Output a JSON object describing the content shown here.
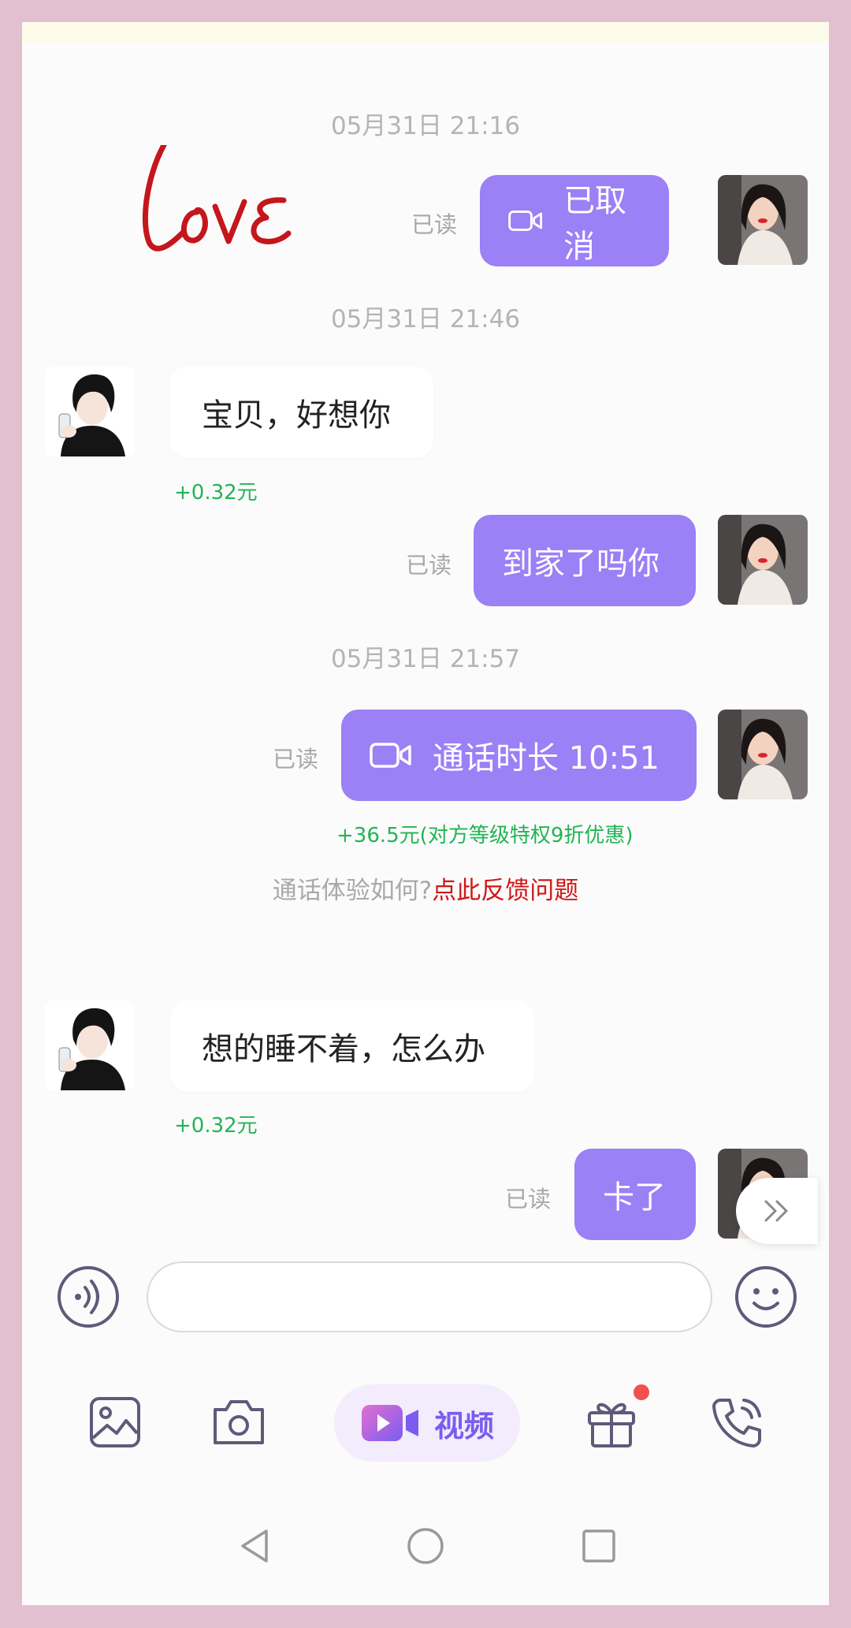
{
  "chat": {
    "messages": [
      {
        "type": "timestamp",
        "text": "05月31日 21:16"
      },
      {
        "type": "call",
        "direction": "out",
        "status_text": "已取消",
        "read_label": "已读"
      },
      {
        "type": "timestamp",
        "text": "05月31日 21:46"
      },
      {
        "type": "text",
        "direction": "in",
        "text": "宝贝，好想你",
        "fee": "+0.32元"
      },
      {
        "type": "text",
        "direction": "out",
        "text": "到家了吗你",
        "read_label": "已读"
      },
      {
        "type": "timestamp",
        "text": "05月31日 21:57"
      },
      {
        "type": "call",
        "direction": "out",
        "status_text": "通话时长 10:51",
        "read_label": "已读",
        "fee": "+36.5元(对方等级特权9折优惠)"
      },
      {
        "type": "feedback",
        "prompt": "通话体验如何?",
        "link": "点此反馈问题"
      },
      {
        "type": "text",
        "direction": "in",
        "text": "想的睡不着，怎么办",
        "fee": "+0.32元"
      },
      {
        "type": "text",
        "direction": "out",
        "text": "卡了",
        "read_label": "已读"
      }
    ]
  },
  "input": {
    "value": "",
    "placeholder": ""
  },
  "toolbar": {
    "video_label": "视频",
    "gift_has_badge": true
  },
  "icons": {
    "voice": "voice-wave-icon",
    "emoji": "smiley-icon",
    "image": "image-icon",
    "camera": "camera-icon",
    "video": "video-camera-icon",
    "gift": "gift-icon",
    "phone": "phone-call-icon",
    "more": "double-chevron-right-icon",
    "nav_back": "triangle-back-icon",
    "nav_home": "circle-home-icon",
    "nav_recent": "square-recent-icon"
  },
  "colors": {
    "outgoing_bubble": "#9b80f6",
    "incoming_bubble": "#ffffff",
    "fee": "#22b455",
    "feedback_link": "#d21717",
    "accent": "#7a5df0",
    "frame": "#e3c0cf",
    "badge": "#f05050"
  }
}
